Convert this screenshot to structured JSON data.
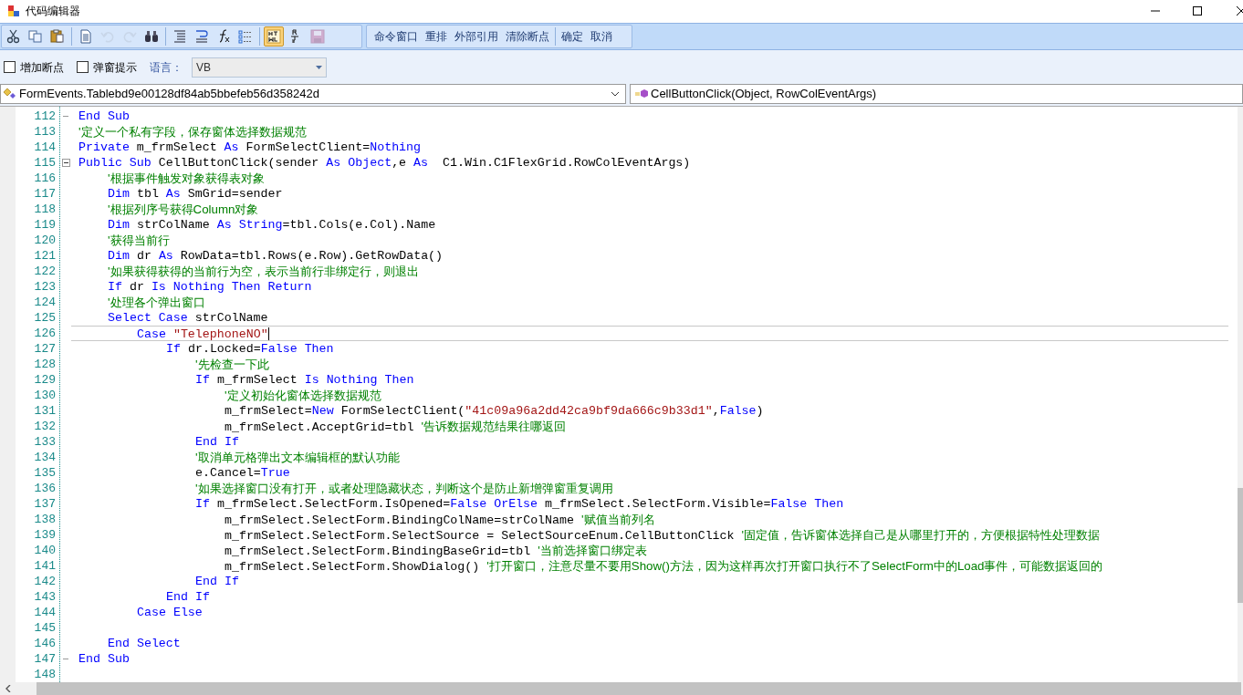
{
  "window": {
    "title": "代码编辑器"
  },
  "toolbar": {
    "icons": [
      {
        "kind": "cut",
        "disabled": false,
        "selected": false
      },
      {
        "kind": "copy",
        "disabled": false,
        "selected": false
      },
      {
        "kind": "paste",
        "disabled": false,
        "selected": false
      },
      {
        "kind": "separator"
      },
      {
        "kind": "document",
        "disabled": false,
        "selected": false
      },
      {
        "kind": "undo",
        "disabled": true,
        "selected": false
      },
      {
        "kind": "redo",
        "disabled": true,
        "selected": false
      },
      {
        "kind": "find",
        "disabled": false,
        "selected": false
      },
      {
        "kind": "separator"
      },
      {
        "kind": "lines",
        "disabled": false,
        "selected": false
      },
      {
        "kind": "wrap",
        "disabled": false,
        "selected": false
      },
      {
        "kind": "function",
        "disabled": false,
        "selected": false
      },
      {
        "kind": "list",
        "disabled": false,
        "selected": false
      },
      {
        "kind": "separator"
      },
      {
        "kind": "html",
        "disabled": false,
        "selected": true
      },
      {
        "kind": "rtf",
        "disabled": false,
        "selected": false
      },
      {
        "kind": "save",
        "disabled": true,
        "selected": false
      }
    ],
    "buttons": [
      {
        "kind": "button",
        "label": "命令窗口"
      },
      {
        "kind": "button",
        "label": "重排"
      },
      {
        "kind": "button",
        "label": "外部引用"
      },
      {
        "kind": "button",
        "label": "清除断点"
      },
      {
        "kind": "separator"
      },
      {
        "kind": "button",
        "label": "确定"
      },
      {
        "kind": "button",
        "label": "取消"
      }
    ]
  },
  "options": {
    "checkboxes": [
      {
        "label": "增加断点",
        "checked": false
      },
      {
        "label": "弹窗提示",
        "checked": false
      }
    ],
    "language_label": "语言：",
    "language_value": "VB"
  },
  "class_dropdown": "FormEvents.Tablebd9e00128df84ab5bbefeb56d358242d",
  "member_dropdown": "CellButtonClick(Object, RowColEventArgs)",
  "code_lines": [
    {
      "number": "112",
      "kind": "fold_end",
      "current": false,
      "tokens": [
        {
          "kind": "keyword",
          "text": "End Sub"
        }
      ]
    },
    {
      "number": "113",
      "kind": "line",
      "current": false,
      "tokens": [
        {
          "kind": "comment",
          "text": "'定义一个私有字段，保存窗体选择数据规范"
        }
      ]
    },
    {
      "number": "114",
      "kind": "line",
      "current": false,
      "tokens": [
        {
          "kind": "keyword",
          "text": "Private"
        },
        {
          "kind": "plain",
          "text": " m_frmSelect "
        },
        {
          "kind": "keyword",
          "text": "As"
        },
        {
          "kind": "plain",
          "text": " FormSelectClient="
        },
        {
          "kind": "keyword",
          "text": "Nothing"
        }
      ]
    },
    {
      "number": "115",
      "kind": "fold_start",
      "current": false,
      "tokens": [
        {
          "kind": "keyword",
          "text": "Public Sub"
        },
        {
          "kind": "plain",
          "text": " CellButtonClick(sender "
        },
        {
          "kind": "keyword",
          "text": "As Object"
        },
        {
          "kind": "plain",
          "text": ",e "
        },
        {
          "kind": "keyword",
          "text": "As"
        },
        {
          "kind": "plain",
          "text": "  C1.Win.C1FlexGrid.RowColEventArgs)"
        }
      ]
    },
    {
      "number": "116",
      "kind": "line",
      "current": false,
      "tokens": [
        {
          "kind": "comment",
          "text": "    '根据事件触发对象获得表对象"
        }
      ]
    },
    {
      "number": "117",
      "kind": "line",
      "current": false,
      "tokens": [
        {
          "kind": "keyword",
          "text": "    Dim"
        },
        {
          "kind": "plain",
          "text": " tbl "
        },
        {
          "kind": "keyword",
          "text": "As"
        },
        {
          "kind": "plain",
          "text": " SmGrid=sender"
        }
      ]
    },
    {
      "number": "118",
      "kind": "line",
      "current": false,
      "tokens": [
        {
          "kind": "comment",
          "text": "    '根据列序号获得Column对象"
        }
      ]
    },
    {
      "number": "119",
      "kind": "line",
      "current": false,
      "tokens": [
        {
          "kind": "keyword",
          "text": "    Dim"
        },
        {
          "kind": "plain",
          "text": " strColName "
        },
        {
          "kind": "keyword",
          "text": "As String"
        },
        {
          "kind": "plain",
          "text": "=tbl.Cols(e.Col).Name"
        }
      ]
    },
    {
      "number": "120",
      "kind": "line",
      "current": false,
      "tokens": [
        {
          "kind": "comment",
          "text": "    '获得当前行"
        }
      ]
    },
    {
      "number": "121",
      "kind": "line",
      "current": false,
      "tokens": [
        {
          "kind": "keyword",
          "text": "    Dim"
        },
        {
          "kind": "plain",
          "text": " dr "
        },
        {
          "kind": "keyword",
          "text": "As"
        },
        {
          "kind": "plain",
          "text": " RowData=tbl.Rows(e.Row).GetRowData()"
        }
      ]
    },
    {
      "number": "122",
      "kind": "line",
      "current": false,
      "tokens": [
        {
          "kind": "comment",
          "text": "    '如果获得获得的当前行为空，表示当前行非绑定行，则退出"
        }
      ]
    },
    {
      "number": "123",
      "kind": "line",
      "current": false,
      "tokens": [
        {
          "kind": "keyword",
          "text": "    If"
        },
        {
          "kind": "plain",
          "text": " dr "
        },
        {
          "kind": "keyword",
          "text": "Is Nothing Then Return"
        }
      ]
    },
    {
      "number": "124",
      "kind": "line",
      "current": false,
      "tokens": [
        {
          "kind": "comment",
          "text": "    '处理各个弹出窗口"
        }
      ]
    },
    {
      "number": "125",
      "kind": "line",
      "current": false,
      "tokens": [
        {
          "kind": "keyword",
          "text": "    Select Case"
        },
        {
          "kind": "plain",
          "text": " strColName"
        }
      ]
    },
    {
      "number": "126",
      "kind": "line",
      "current": true,
      "tokens": [
        {
          "kind": "keyword",
          "text": "        Case "
        },
        {
          "kind": "string",
          "text": "\"TelephoneNO\""
        }
      ]
    },
    {
      "number": "127",
      "kind": "line",
      "current": false,
      "tokens": [
        {
          "kind": "keyword",
          "text": "            If"
        },
        {
          "kind": "plain",
          "text": " dr.Locked="
        },
        {
          "kind": "keyword",
          "text": "False Then"
        }
      ]
    },
    {
      "number": "128",
      "kind": "line",
      "current": false,
      "tokens": [
        {
          "kind": "comment",
          "text": "                '先检查一下此"
        }
      ]
    },
    {
      "number": "129",
      "kind": "line",
      "current": false,
      "tokens": [
        {
          "kind": "keyword",
          "text": "                If"
        },
        {
          "kind": "plain",
          "text": " m_frmSelect "
        },
        {
          "kind": "keyword",
          "text": "Is Nothing Then"
        }
      ]
    },
    {
      "number": "130",
      "kind": "line",
      "current": false,
      "tokens": [
        {
          "kind": "comment",
          "text": "                    '定义初始化窗体选择数据规范"
        }
      ]
    },
    {
      "number": "131",
      "kind": "line",
      "current": false,
      "tokens": [
        {
          "kind": "plain",
          "text": "                    m_frmSelect="
        },
        {
          "kind": "keyword",
          "text": "New"
        },
        {
          "kind": "plain",
          "text": " FormSelectClient("
        },
        {
          "kind": "string",
          "text": "\"41c09a96a2dd42ca9bf9da666c9b33d1\""
        },
        {
          "kind": "plain",
          "text": ","
        },
        {
          "kind": "keyword",
          "text": "False"
        },
        {
          "kind": "plain",
          "text": ")"
        }
      ]
    },
    {
      "number": "132",
      "kind": "line",
      "current": false,
      "tokens": [
        {
          "kind": "plain",
          "text": "                    m_frmSelect.AcceptGrid=tbl "
        },
        {
          "kind": "comment",
          "text": "'告诉数据规范结果往哪返回"
        }
      ]
    },
    {
      "number": "133",
      "kind": "line",
      "current": false,
      "tokens": [
        {
          "kind": "keyword",
          "text": "                End If"
        }
      ]
    },
    {
      "number": "134",
      "kind": "line",
      "current": false,
      "tokens": [
        {
          "kind": "comment",
          "text": "                '取消单元格弹出文本编辑框的默认功能"
        }
      ]
    },
    {
      "number": "135",
      "kind": "line",
      "current": false,
      "tokens": [
        {
          "kind": "plain",
          "text": "                e.Cancel="
        },
        {
          "kind": "keyword",
          "text": "True"
        }
      ]
    },
    {
      "number": "136",
      "kind": "line",
      "current": false,
      "tokens": [
        {
          "kind": "comment",
          "text": "                '如果选择窗口没有打开，或者处理隐藏状态，判断这个是防止新增弹窗重复调用"
        }
      ]
    },
    {
      "number": "137",
      "kind": "line",
      "current": false,
      "tokens": [
        {
          "kind": "keyword",
          "text": "                If"
        },
        {
          "kind": "plain",
          "text": " m_frmSelect.SelectForm.IsOpened="
        },
        {
          "kind": "keyword",
          "text": "False OrElse"
        },
        {
          "kind": "plain",
          "text": " m_frmSelect.SelectForm.Visible="
        },
        {
          "kind": "keyword",
          "text": "False Then"
        }
      ]
    },
    {
      "number": "138",
      "kind": "line",
      "current": false,
      "tokens": [
        {
          "kind": "plain",
          "text": "                    m_frmSelect.SelectForm.BindingColName=strColName "
        },
        {
          "kind": "comment",
          "text": "'赋值当前列名"
        }
      ]
    },
    {
      "number": "139",
      "kind": "line",
      "current": false,
      "tokens": [
        {
          "kind": "plain",
          "text": "                    m_frmSelect.SelectForm.SelectSource = SelectSourceEnum.CellButtonClick "
        },
        {
          "kind": "comment",
          "text": "'固定值，告诉窗体选择自己是从哪里打开的，方便根据特性处理数据"
        }
      ]
    },
    {
      "number": "140",
      "kind": "line",
      "current": false,
      "tokens": [
        {
          "kind": "plain",
          "text": "                    m_frmSelect.SelectForm.BindingBaseGrid=tbl "
        },
        {
          "kind": "comment",
          "text": "'当前选择窗口绑定表"
        }
      ]
    },
    {
      "number": "141",
      "kind": "line",
      "current": false,
      "tokens": [
        {
          "kind": "plain",
          "text": "                    m_frmSelect.SelectForm.ShowDialog() "
        },
        {
          "kind": "comment",
          "text": "'打开窗口，注意尽量不要用Show()方法，因为这样再次打开窗口执行不了SelectForm中的Load事件，可能数据返回的"
        }
      ]
    },
    {
      "number": "142",
      "kind": "line",
      "current": false,
      "tokens": [
        {
          "kind": "keyword",
          "text": "                End If"
        }
      ]
    },
    {
      "number": "143",
      "kind": "line",
      "current": false,
      "tokens": [
        {
          "kind": "keyword",
          "text": "            End If"
        }
      ]
    },
    {
      "number": "144",
      "kind": "line",
      "current": false,
      "tokens": [
        {
          "kind": "keyword",
          "text": "        Case Else"
        }
      ]
    },
    {
      "number": "145",
      "kind": "line",
      "current": false
    },
    {
      "number": "146",
      "kind": "line",
      "current": false,
      "tokens": [
        {
          "kind": "keyword",
          "text": "    End Select"
        }
      ]
    },
    {
      "number": "147",
      "kind": "fold_end",
      "current": false,
      "tokens": [
        {
          "kind": "keyword",
          "text": "End Sub"
        }
      ]
    },
    {
      "number": "148",
      "kind": "line",
      "current": false
    }
  ]
}
